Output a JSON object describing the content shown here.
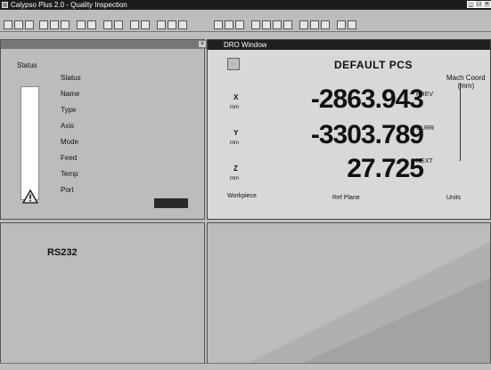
{
  "window": {
    "title": "Calypso Plus 2.0 - Quality Inspection"
  },
  "left_panel": {
    "tab_label": "Status",
    "properties": [
      {
        "label": "Status",
        "value": ""
      },
      {
        "label": "Name",
        "value": ""
      },
      {
        "label": "Type",
        "value": ""
      },
      {
        "label": "Axis",
        "value": ""
      },
      {
        "label": "Mode",
        "value": ""
      },
      {
        "label": "Feed",
        "value": ""
      },
      {
        "label": "Temp",
        "value": ""
      },
      {
        "label": "Port",
        "value": ""
      }
    ]
  },
  "right_panel": {
    "title": "DRO Window",
    "pcs_label": "DEFAULT PCS",
    "machine_label": "Mach Coord",
    "machine_label2": "(mm)",
    "rows": [
      {
        "axis": "X",
        "unit": "mm",
        "value": "-2863.943",
        "side_label": "PREV",
        "side_value": ""
      },
      {
        "axis": "Y",
        "unit": "mm",
        "value": "-3303.789",
        "side_label": "CURR",
        "side_value": ""
      },
      {
        "axis": "Z",
        "unit": "mm",
        "value": "27.725",
        "side_label": "NEXT",
        "side_value": ""
      }
    ],
    "bottom_left": "Workpiece",
    "bottom_mid": "Ref Plane",
    "bottom_right": "Units"
  },
  "lower_left": {
    "label": "RS232"
  }
}
